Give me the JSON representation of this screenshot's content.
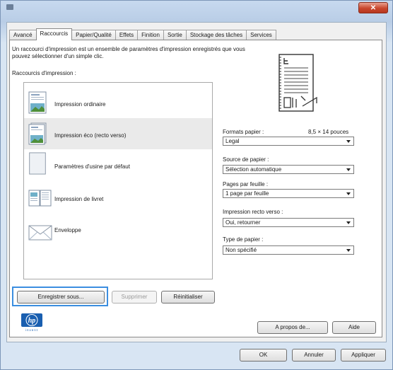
{
  "window": {
    "close_label": "✕"
  },
  "tabs": [
    {
      "label": "Avancé"
    },
    {
      "label": "Raccourcis"
    },
    {
      "label": "Papier/Qualité"
    },
    {
      "label": "Effets"
    },
    {
      "label": "Finition"
    },
    {
      "label": "Sortie"
    },
    {
      "label": "Stockage des tâches"
    },
    {
      "label": "Services"
    }
  ],
  "description": "Un raccourci d'impression est un ensemble de paramètres d'impression enregistrés que vous pouvez sélectionner d'un simple clic.",
  "shortcuts_label": "Raccourcis d'impression :",
  "shortcuts": [
    {
      "label": "Impression ordinaire",
      "icon": "document-page-icon"
    },
    {
      "label": "Impression éco (recto verso)",
      "icon": "duplex-document-icon"
    },
    {
      "label": "Paramètres d'usine par défaut",
      "icon": "blank-page-icon"
    },
    {
      "label": "Impression de livret",
      "icon": "booklet-icon"
    },
    {
      "label": "Enveloppe",
      "icon": "envelope-icon"
    }
  ],
  "fields": {
    "paper_size": {
      "label": "Formats papier :",
      "size_text": "8,5 × 14 pouces",
      "value": "Legal"
    },
    "paper_source": {
      "label": "Source de papier :",
      "value": "Sélection automatique"
    },
    "pages_per_sheet": {
      "label": "Pages par feuille :",
      "value": "1 page par feuille"
    },
    "duplex": {
      "label": "Impression recto verso :",
      "value": "Oui, retourner"
    },
    "paper_type": {
      "label": "Type de papier :",
      "value": "Non spécifié"
    }
  },
  "buttons": {
    "save_as": "Enregistrer sous...",
    "delete": "Supprimer",
    "reset": "Réinitialiser",
    "about": "A propos de...",
    "help": "Aide",
    "ok": "OK",
    "cancel": "Annuler",
    "apply": "Appliquer"
  },
  "logo": {
    "text": "hp",
    "tagline": "invent"
  }
}
